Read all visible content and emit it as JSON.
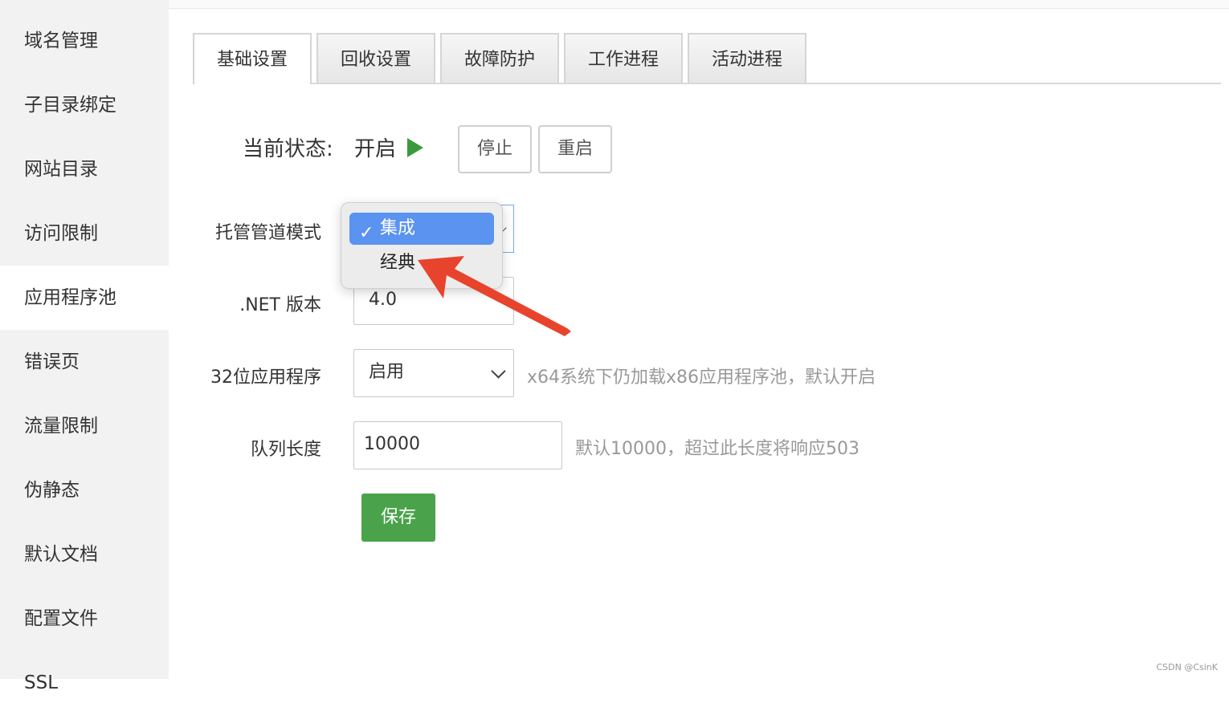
{
  "sidebar": {
    "items": [
      {
        "label": "域名管理"
      },
      {
        "label": "子目录绑定"
      },
      {
        "label": "网站目录"
      },
      {
        "label": "访问限制"
      },
      {
        "label": "应用程序池"
      },
      {
        "label": "错误页"
      },
      {
        "label": "流量限制"
      },
      {
        "label": "伪静态"
      },
      {
        "label": "默认文档"
      },
      {
        "label": "配置文件"
      },
      {
        "label": "SSL"
      }
    ],
    "active": "应用程序池"
  },
  "tabs": [
    {
      "label": "基础设置"
    },
    {
      "label": "回收设置"
    },
    {
      "label": "故障防护"
    },
    {
      "label": "工作进程"
    },
    {
      "label": "活动进程"
    }
  ],
  "status": {
    "label": "当前状态:",
    "value": "开启",
    "stop_label": "停止",
    "restart_label": "重启"
  },
  "form": {
    "pipeline": {
      "label": "托管管道模式",
      "options": [
        "集成",
        "经典"
      ],
      "selected": "集成"
    },
    "dotnet": {
      "label": ".NET 版本",
      "value": "4.0"
    },
    "bit32": {
      "label": "32位应用程序",
      "value": "启用",
      "hint": "x64系统下仍加载x86应用程序池，默认开启"
    },
    "queue": {
      "label": "队列长度",
      "value": "10000",
      "hint": "默认10000，超过此长度将响应503"
    },
    "save_label": "保存"
  },
  "annotation": {
    "arrow_color": "#e8432d"
  },
  "colors": {
    "accent_green": "#4aa34a",
    "selection_blue": "#5a93f0"
  },
  "watermark": "CSDN @CsinK"
}
